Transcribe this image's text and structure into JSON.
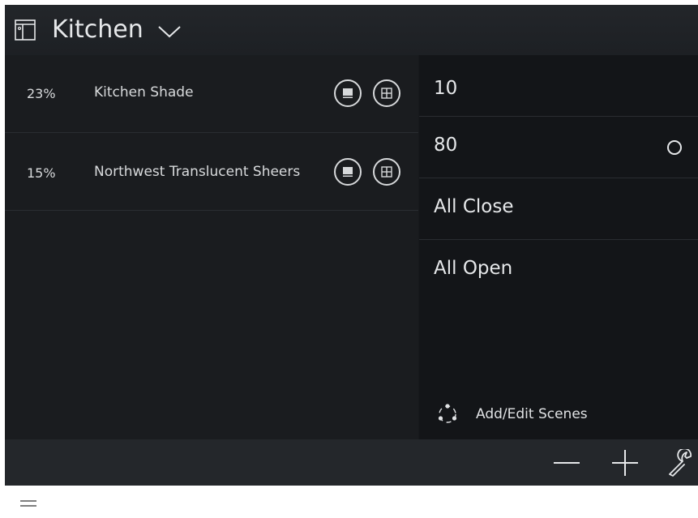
{
  "header": {
    "title": "Kitchen",
    "room_icon": "room-icon",
    "dropdown_icon": "chevron-down-icon"
  },
  "shades": [
    {
      "percent": "23%",
      "name": "Kitchen Shade"
    },
    {
      "percent": "15%",
      "name": "Northwest Translucent Sheers"
    }
  ],
  "scenes": [
    {
      "label": "10"
    },
    {
      "label": "80",
      "radio": true
    },
    {
      "label": "All Close"
    },
    {
      "label": "All Open"
    }
  ],
  "add_scenes": {
    "label": "Add/Edit Scenes"
  },
  "toolbar": {
    "minus": "minus-icon",
    "plus": "plus-icon",
    "wrench": "wrench-icon"
  },
  "colors": {
    "background": "#17191c",
    "text": "#e6e8ea",
    "panel": "#131518"
  }
}
